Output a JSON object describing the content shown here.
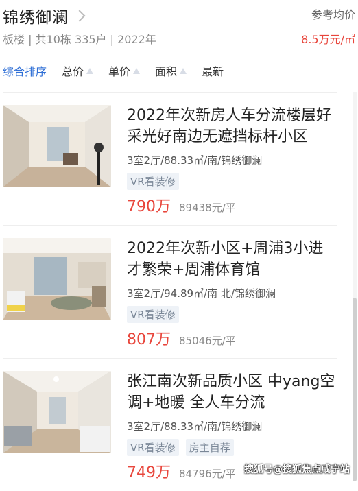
{
  "header": {
    "title": "锦绣御澜",
    "subinfo": "板楼 | 共10栋 335户 | 2022年",
    "ref_label": "参考均价",
    "ref_price": "8.5万元/㎡"
  },
  "sort": {
    "items": [
      {
        "label": "综合排序"
      },
      {
        "label": "总价"
      },
      {
        "label": "单价"
      },
      {
        "label": "面积"
      },
      {
        "label": "最新"
      }
    ]
  },
  "listings": [
    {
      "title": "2022年次新房人车分流楼层好采光好南边无遮挡标杆小区",
      "meta": "3室2厅/88.33㎡/南/锦绣御澜",
      "tags": [
        "VR看装修"
      ],
      "price": "790万",
      "unit_price": "89438元/平"
    },
    {
      "title": "2022年次新小区+周浦3小进才繁荣+周浦体育馆",
      "meta": "3室2厅/94.89㎡/南 北/锦绣御澜",
      "tags": [
        "VR看装修"
      ],
      "price": "807万",
      "unit_price": "85046元/平"
    },
    {
      "title": "张江南次新品质小区 中yang空调+地暖 全人车分流",
      "meta": "3室2厅/88.33㎡/南/锦绣御澜",
      "tags": [
        "VR看装修",
        "房主自荐"
      ],
      "price": "749万",
      "unit_price": "84796元/平"
    }
  ],
  "watermark": "搜狐号@搜狐焦点咸宁站",
  "colors": {
    "accent": "#2f6fd6",
    "price": "#e8463c",
    "tag_bg": "#eef2f7"
  }
}
